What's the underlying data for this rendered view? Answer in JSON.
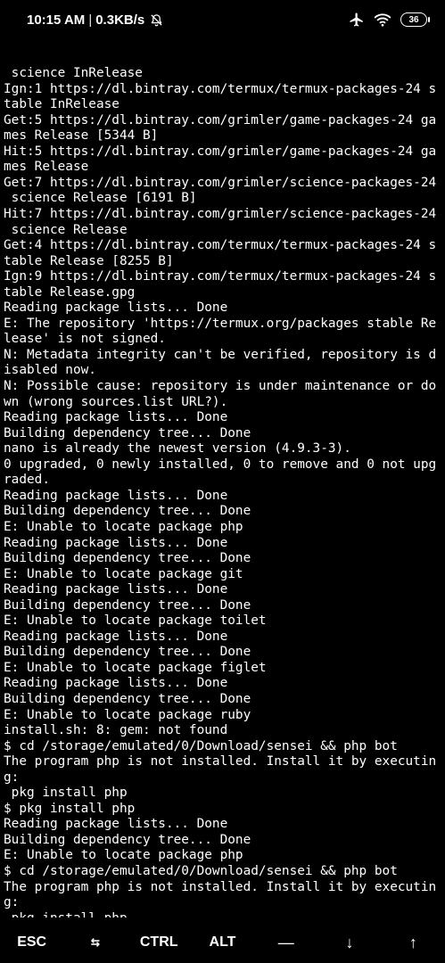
{
  "status_bar": {
    "time": "10:15 AM",
    "separator": "|",
    "net_speed": "0.3KB/s",
    "battery_level": "36"
  },
  "terminal": {
    "lines": [
      " science InRelease",
      "Ign:1 https://dl.bintray.com/termux/termux-packages-24 s",
      "table InRelease",
      "Get:5 https://dl.bintray.com/grimler/game-packages-24 ga",
      "mes Release [5344 B]",
      "Hit:5 https://dl.bintray.com/grimler/game-packages-24 ga",
      "mes Release",
      "Get:7 https://dl.bintray.com/grimler/science-packages-24",
      " science Release [6191 B]",
      "Hit:7 https://dl.bintray.com/grimler/science-packages-24",
      " science Release",
      "Get:4 https://dl.bintray.com/termux/termux-packages-24 s",
      "table Release [8255 B]",
      "Ign:9 https://dl.bintray.com/termux/termux-packages-24 s",
      "table Release.gpg",
      "Reading package lists... Done",
      "E: The repository 'https://termux.org/packages stable Re",
      "lease' is not signed.",
      "N: Metadata integrity can't be verified, repository is d",
      "isabled now.",
      "N: Possible cause: repository is under maintenance or do",
      "wn (wrong sources.list URL?).",
      "Reading package lists... Done",
      "Building dependency tree... Done",
      "nano is already the newest version (4.9.3-3).",
      "0 upgraded, 0 newly installed, 0 to remove and 0 not upg",
      "raded.",
      "Reading package lists... Done",
      "Building dependency tree... Done",
      "E: Unable to locate package php",
      "Reading package lists... Done",
      "Building dependency tree... Done",
      "E: Unable to locate package git",
      "Reading package lists... Done",
      "Building dependency tree... Done",
      "E: Unable to locate package toilet",
      "Reading package lists... Done",
      "Building dependency tree... Done",
      "E: Unable to locate package figlet",
      "Reading package lists... Done",
      "Building dependency tree... Done",
      "E: Unable to locate package ruby",
      "install.sh: 8: gem: not found",
      "$ cd /storage/emulated/0/Download/sensei && php bot",
      "The program php is not installed. Install it by executin",
      "g:",
      " pkg install php",
      "$ pkg install php",
      "Reading package lists... Done",
      "Building dependency tree... Done",
      "E: Unable to locate package php",
      "$ cd /storage/emulated/0/Download/sensei && php bot",
      "The program php is not installed. Install it by executin",
      "g:",
      " pkg install php"
    ],
    "prompt": "$"
  },
  "extra_keys": {
    "esc": "ESC",
    "tab": "⇆",
    "ctrl": "CTRL",
    "alt": "ALT",
    "dash": "—",
    "down": "↓",
    "up": "↑"
  }
}
